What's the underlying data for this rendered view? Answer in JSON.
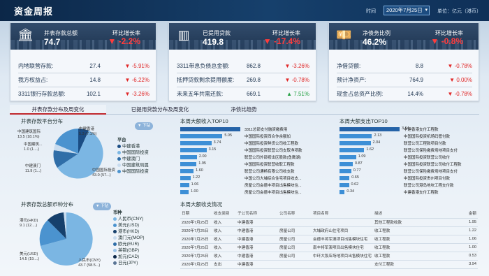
{
  "header": {
    "title": "资金周报",
    "time_label": "时间",
    "date": "2020年7月25日",
    "unit_label": "单位：亿元（港币）"
  },
  "cards": [
    {
      "icon": "bank-icon",
      "name": "并表存款总额",
      "value": "74.7",
      "growth_label": "环比增长率",
      "growth": "-2.2%",
      "rows": [
        {
          "name": "内地联营存款:",
          "value": "27.4",
          "growth": "-5.91%",
          "dir": "down"
        },
        {
          "name": "我方权益占:",
          "value": "14.8",
          "growth": "-6.22%",
          "dir": "down"
        },
        {
          "name": "3311银行存款总额:",
          "value": "102.1",
          "growth": "-3.26%",
          "dir": "down"
        }
      ]
    },
    {
      "icon": "bar-chart-icon",
      "name": "已提用贷款",
      "value": "419.8",
      "growth_label": "环比增长率",
      "growth": "-17.4%",
      "rows": [
        {
          "name": "3311带息负债总金额:",
          "value": "862.8",
          "growth": "-3.26%",
          "dir": "down"
        },
        {
          "name": "抵押贷款剩余提用额度:",
          "value": "269.8",
          "growth": "-0.78%",
          "dir": "down"
        },
        {
          "name": "未来五年共需还款:",
          "value": "669.1",
          "growth": "7.51%",
          "dir": "up"
        }
      ]
    },
    {
      "icon": "money-icon",
      "name": "净债务比例",
      "value": "46.2%",
      "growth_label": "环比增长率",
      "growth": "-0.8%",
      "rows": [
        {
          "name": "净借贷额:",
          "value": "8.8",
          "growth": "-0.78%",
          "dir": "down"
        },
        {
          "name": "预计净资产:",
          "value": "764.9",
          "growth": "0.00%",
          "dir": "down"
        },
        {
          "name": "现金占总资产比例:",
          "value": "14.4%",
          "growth": "-0.78%",
          "dir": "down"
        }
      ]
    }
  ],
  "tabs": [
    "并表存款分布及周变化",
    "已提用贷款分布及周变化",
    "净债比趋势"
  ],
  "platform_pie": {
    "title": "并表存款平台分布",
    "pill": "下钻",
    "legend_title": "平台",
    "legend": [
      "中建香港",
      "中国国际投资",
      "中建澳门",
      "中国建筑局属",
      "中国国际投资"
    ],
    "labels": [
      "中建香港\n5.3 (7.1%)",
      "中国建筑国际\n13.5 (18.1%)",
      "中国建筑...\n1.0 (1....)",
      "中建澳门\n11.9 (1...)",
      "中国国际投资\n43.0 (57...)"
    ]
  },
  "currency_pie": {
    "title": "并表存款总额币种分布",
    "pill": "下钻",
    "legend_title": "币种",
    "legend": [
      "人民币(CNY)",
      "美元(USD)",
      "港币(HKD)",
      "澳门元(MOP)",
      "欧元(EUR)",
      "英镑(GBP)",
      "加元(CAD)",
      "日元(JPY)"
    ],
    "labels": [
      "港元(HKD)\n9.1 (12....)",
      "美元(USD)\n14.5 (19....)",
      "人民币(CNY)\n43.7 (58.5...)"
    ]
  },
  "income_top": {
    "title": "本周大额收入TOP10",
    "rows": [
      {
        "v": "",
        "l": "3311总部支付融资缴费用"
      },
      {
        "v": "5.05",
        "l": "中国国际投资西合作余额加"
      },
      {
        "v": "3.74",
        "l": "中国国际投资鲜货公司收工程款"
      },
      {
        "v": "3.15",
        "l": "中国国际投资联营公司支取净项款"
      },
      {
        "v": "2.00",
        "l": "联营公司外部按出区股款(鱼鹰湖)"
      },
      {
        "v": "1.95",
        "l": "中国国际投资联营收取工程款"
      },
      {
        "v": "1.60",
        "l": "联营公司通畅有限公司收支款"
      },
      {
        "v": "1.22",
        "l": "中国公司大埔综合住宅项目收支..."
      },
      {
        "v": "1.06",
        "l": "房屋公司会德丰项目出售模块住..."
      },
      {
        "v": "1.00",
        "l": "房屋公司会德丰项目出售模块住..."
      }
    ],
    "values": [
      7.2,
      5.05,
      3.74,
      3.15,
      2.0,
      1.95,
      1.6,
      1.22,
      1.06,
      1.0
    ]
  },
  "expense_top": {
    "title": "本周大额支出TOP10",
    "rows": [
      {
        "v": "3.94",
        "l": "中建香港支付工程款"
      },
      {
        "v": "2.13",
        "l": "中国国际投资机场码管付款"
      },
      {
        "v": "2.04",
        "l": "联营公司工程款项目付款"
      },
      {
        "v": "1.62",
        "l": "联营公司保险缴费场地项目支付"
      },
      {
        "v": "1.09",
        "l": "中国国际投资联营公司收付"
      },
      {
        "v": "0.87",
        "l": "中国国际投资联营公司收付工程款"
      },
      {
        "v": "0.77",
        "l": "联营公司保险缴费场地项目支付"
      },
      {
        "v": "0.65",
        "l": "中国国际投资贵州项目付款"
      },
      {
        "v": "0.62",
        "l": "联营公司港岛地块工程支付款"
      },
      {
        "v": "0.34",
        "l": "中建香港支付工程款"
      }
    ],
    "values": [
      3.94,
      2.13,
      2.04,
      1.62,
      1.09,
      0.87,
      0.77,
      0.65,
      0.62,
      0.34
    ]
  },
  "detail": {
    "title": "本周大额收支情况",
    "cols": [
      "日期",
      "收支类别",
      "子公司名称",
      "公司名称",
      "项目名称",
      "描述",
      "金额"
    ],
    "rows": [
      [
        "2020年7月25日",
        "收入",
        "中建香港",
        "",
        "",
        "其他工程款收款",
        "1.95"
      ],
      [
        "2020年7月25日",
        "收入",
        "中建香港",
        "房屋公司",
        "大埔政府山住宅项目",
        "收工程款",
        "1.22"
      ],
      [
        "2020年7月25日",
        "收入",
        "中建香港",
        "房屋公司",
        "会德丰将军澳项目出售模块住宅",
        "收工程款",
        "1.06"
      ],
      [
        "2020年7月25日",
        "收入",
        "中建香港",
        "房屋公司",
        "南丰将军澳项目出售模块住宅",
        "收工程款",
        "1.00"
      ],
      [
        "2020年7月25日",
        "收入",
        "中建香港",
        "房屋公司",
        "中环大饭店场地项目出售模块住宅",
        "收工程款",
        "0.53"
      ],
      [
        "2020年7月25日",
        "支出",
        "中建香港",
        "",
        "",
        "支付工程款",
        "3.94"
      ]
    ]
  }
}
